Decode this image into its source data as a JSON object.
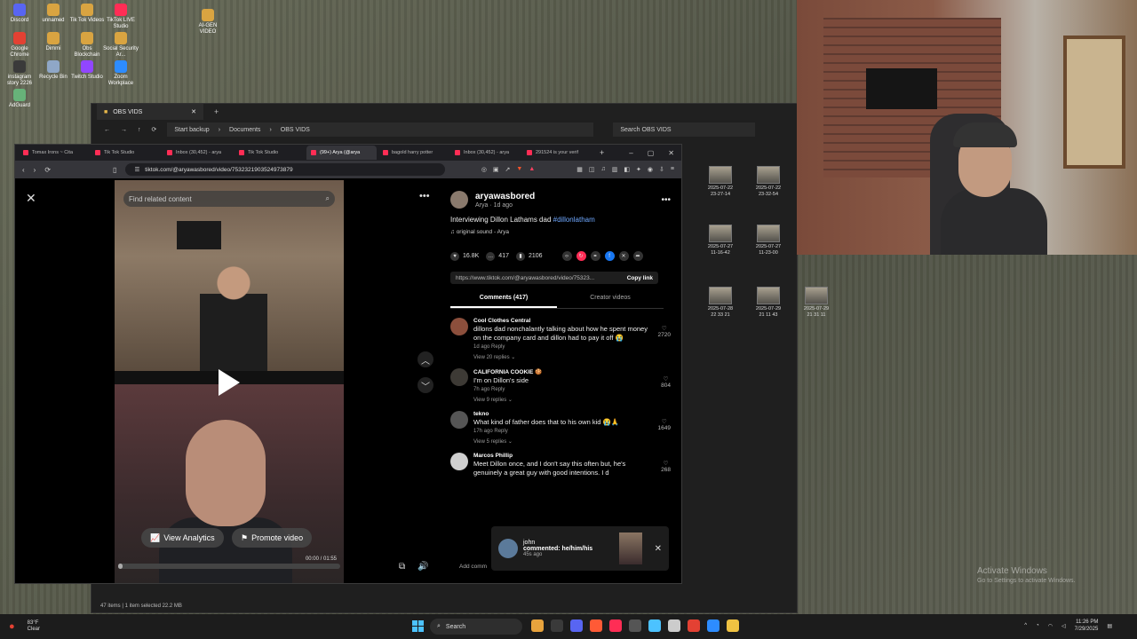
{
  "desktop": {
    "icons": [
      {
        "label": "Discord",
        "color": "#5865f2"
      },
      {
        "label": "unnamed",
        "color": "#d9a441"
      },
      {
        "label": "Tik Tok Videos",
        "color": "#d9a441"
      },
      {
        "label": "TikTok LIVE Studio",
        "color": "#ff2d55"
      },
      {
        "label": "Google Chrome",
        "color": "#e34133"
      },
      {
        "label": "Dimmi",
        "color": "#d9a441"
      },
      {
        "label": "Obs Blockchain",
        "color": "#d9a441"
      },
      {
        "label": "Social Security Ar...",
        "color": "#d9a441"
      },
      {
        "label": "instagram story 2226",
        "color": "#3a3a3a"
      },
      {
        "label": "Recycle Bin",
        "color": "#8fa7c7"
      },
      {
        "label": "Twitch Studio",
        "color": "#9146ff"
      },
      {
        "label": "Zoom Workplace",
        "color": "#2d8cff"
      },
      {
        "label": "AdGuard",
        "color": "#67b279"
      },
      {
        "label": "AI-GEN VIDEO",
        "color": "#d9a441"
      }
    ]
  },
  "explorer": {
    "tab_title": "OBS VIDS",
    "crumbs": [
      "Start backup",
      "Documents",
      "OBS VIDS"
    ],
    "search_placeholder": "Search OBS VIDS",
    "status": "47 items  |  1 item selected  22.2 MB",
    "thumbs": [
      "2025-07-22\n23-27-14",
      "2025-07-22\n23-32-54",
      "2025-07-27\n11-16-42",
      "2025-07-27\n11-23-00",
      "2025-07-27\n11-27-29",
      "2025-07-28\n22 33 21",
      "2025-07-29\n21 11 43",
      "2025-07-29\n21 31 11"
    ]
  },
  "browser": {
    "tabs": [
      {
        "label": "Tomax Irons ~ Cita",
        "active": false
      },
      {
        "label": "Tik Tok Studio",
        "active": false
      },
      {
        "label": "Inbox (30,452) - arya",
        "active": false
      },
      {
        "label": "Tik Tok Studio",
        "active": false
      },
      {
        "label": "(99+) Arya (@arya",
        "active": true
      },
      {
        "label": "bagold harry potter",
        "active": false
      },
      {
        "label": "Inbox (30,452) - arya",
        "active": false
      },
      {
        "label": "291524 is your verif",
        "active": false
      }
    ],
    "url": "tiktok.com/@aryawasbored/video/7532321903524973879"
  },
  "video": {
    "search_placeholder": "Find related content",
    "view_analytics": "View Analytics",
    "promote": "Promote video",
    "time": "00:00 / 01:55",
    "progress": 0.02
  },
  "post": {
    "username": "aryawasbored",
    "subline": "Arya · 1d ago",
    "caption": "Interviewing Dillon Lathams dad ",
    "hashtag": "#dillonlatham",
    "sound": "original sound - Arya",
    "likes": "16.8K",
    "comments": "417",
    "saves": "2106",
    "link": "https://www.tiktok.com/@aryawasbored/video/75323...",
    "copy_link": "Copy link",
    "tab_comments": "Comments (417)",
    "tab_creator": "Creator videos",
    "add_comment": "Add comm"
  },
  "comments": [
    {
      "user": "Cool Clothes Central",
      "text": "dillons dad nonchalantly talking about how he spent money on the company card and dillon had to pay it off 😭",
      "meta": "1d ago   Reply",
      "replies": "View 20 replies ⌄",
      "likes": "2720",
      "color": "#8c4f3c"
    },
    {
      "user": "CALIFORNIA COOKIE 🍪",
      "text": "I'm on Dillon's side",
      "meta": "7h ago   Reply",
      "replies": "View 9 replies ⌄",
      "likes": "804",
      "color": "#3d3a35"
    },
    {
      "user": "tekno",
      "text": "What kind of father does that to his own kid 😭🙏",
      "meta": "17h ago   Reply",
      "replies": "View 5 replies ⌄",
      "likes": "1649",
      "color": "#555"
    },
    {
      "user": "Marcos Phillip",
      "text": "Meet Dillon once, and I don't say this often but, he's genuinely a great guy with good intentions. I d",
      "meta": "",
      "replies": "",
      "likes": "268",
      "color": "#cfcfcf"
    }
  ],
  "notification": {
    "user": "john",
    "text": "commented: he/him/his",
    "time": "45s ago"
  },
  "watermark": {
    "line1": "Activate Windows",
    "line2": "Go to Settings to activate Windows."
  },
  "taskbar": {
    "weather_temp": "83°F",
    "weather_desc": "Clear",
    "search": "Search",
    "time": "11:26 PM",
    "date": "7/29/2025",
    "app_colors": [
      "#e8a33d",
      "#3a3a3a",
      "#5865f2",
      "#ff5a36",
      "#ff2d55",
      "#555",
      "#4cc2ff",
      "#ccc",
      "#e34133",
      "#2d8cff",
      "#f0c242"
    ]
  }
}
